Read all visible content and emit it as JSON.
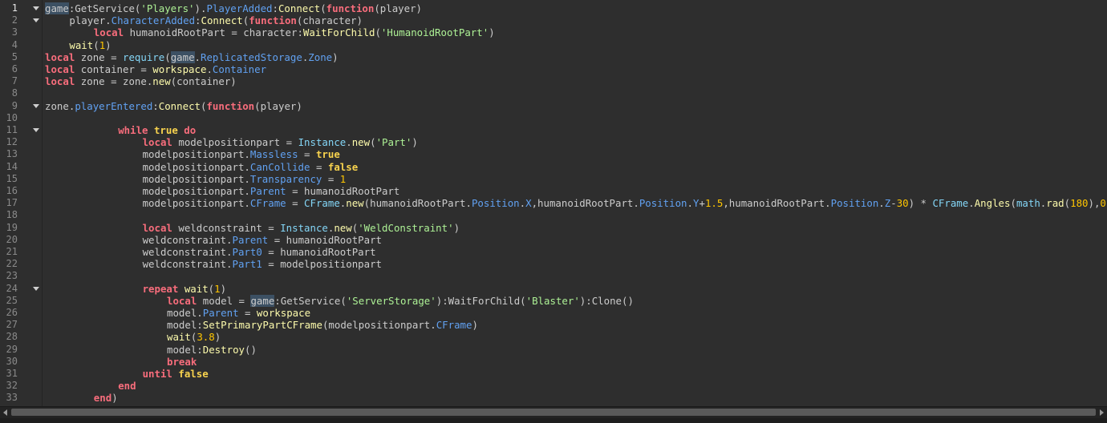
{
  "editor": {
    "current_line": 1,
    "colors": {
      "background": "#2e2e2e",
      "plain": "#cccccc",
      "keyword": "#f86d7c",
      "boolean": "#f8d34e",
      "string": "#adf195",
      "number": "#ffc600",
      "property": "#61a1f1",
      "method": "#fdfbac",
      "builtin": "#84d6f7",
      "highlight": "#3c5063"
    },
    "lines": [
      {
        "n": "1",
        "indent": 0,
        "fold": true,
        "tokens": [
          [
            "hl",
            "game"
          ],
          [
            "p",
            ":GetService("
          ],
          [
            "s",
            "'Players'"
          ],
          [
            "p",
            ")."
          ],
          [
            "prop",
            "PlayerAdded"
          ],
          [
            "p",
            ":"
          ],
          [
            "fn",
            "Connect"
          ],
          [
            "p",
            "("
          ],
          [
            "kw",
            "function"
          ],
          [
            "p",
            "(player)"
          ]
        ]
      },
      {
        "n": "2",
        "indent": 4,
        "fold": true,
        "tokens": [
          [
            "p",
            "player."
          ],
          [
            "prop",
            "CharacterAdded"
          ],
          [
            "p",
            ":"
          ],
          [
            "fn",
            "Connect"
          ],
          [
            "p",
            "("
          ],
          [
            "kw",
            "function"
          ],
          [
            "p",
            "(character)"
          ]
        ]
      },
      {
        "n": "3",
        "indent": 8,
        "tokens": [
          [
            "kw",
            "local"
          ],
          [
            "p",
            " humanoidRootPart = character:"
          ],
          [
            "fn",
            "WaitForChild"
          ],
          [
            "p",
            "("
          ],
          [
            "s",
            "'HumanoidRootPart'"
          ],
          [
            "p",
            ")"
          ]
        ]
      },
      {
        "n": "4",
        "indent": 4,
        "tokens": [
          [
            "fn",
            "wait"
          ],
          [
            "p",
            "("
          ],
          [
            "num",
            "1"
          ],
          [
            "p",
            ")"
          ]
        ]
      },
      {
        "n": "5",
        "indent": 0,
        "tokens": [
          [
            "kw",
            "local"
          ],
          [
            "p",
            " zone = "
          ],
          [
            "bi",
            "require"
          ],
          [
            "p",
            "("
          ],
          [
            "hl",
            "game"
          ],
          [
            "p",
            "."
          ],
          [
            "prop",
            "ReplicatedStorage"
          ],
          [
            "p",
            "."
          ],
          [
            "prop",
            "Zone"
          ],
          [
            "p",
            ")"
          ]
        ]
      },
      {
        "n": "6",
        "indent": 0,
        "tokens": [
          [
            "kw",
            "local"
          ],
          [
            "p",
            " container = "
          ],
          [
            "fn",
            "workspace"
          ],
          [
            "p",
            "."
          ],
          [
            "prop",
            "Container"
          ]
        ]
      },
      {
        "n": "7",
        "indent": 0,
        "tokens": [
          [
            "kw",
            "local"
          ],
          [
            "p",
            " zone = zone."
          ],
          [
            "fn",
            "new"
          ],
          [
            "p",
            "(container)"
          ]
        ]
      },
      {
        "n": "8",
        "indent": 0,
        "tokens": []
      },
      {
        "n": "9",
        "indent": 0,
        "fold": true,
        "tokens": [
          [
            "p",
            "zone."
          ],
          [
            "prop",
            "playerEntered"
          ],
          [
            "p",
            ":"
          ],
          [
            "fn",
            "Connect"
          ],
          [
            "p",
            "("
          ],
          [
            "kw",
            "function"
          ],
          [
            "p",
            "(player)"
          ]
        ]
      },
      {
        "n": "10",
        "indent": 0,
        "tokens": []
      },
      {
        "n": "11",
        "indent": 12,
        "fold": true,
        "tokens": [
          [
            "kw",
            "while"
          ],
          [
            "p",
            " "
          ],
          [
            "kwb",
            "true"
          ],
          [
            "p",
            " "
          ],
          [
            "kw",
            "do"
          ]
        ]
      },
      {
        "n": "12",
        "indent": 16,
        "tokens": [
          [
            "kw",
            "local"
          ],
          [
            "p",
            " modelpositionpart = "
          ],
          [
            "bi",
            "Instance"
          ],
          [
            "p",
            "."
          ],
          [
            "fn",
            "new"
          ],
          [
            "p",
            "("
          ],
          [
            "s",
            "'Part'"
          ],
          [
            "p",
            ")"
          ]
        ]
      },
      {
        "n": "13",
        "indent": 16,
        "tokens": [
          [
            "p",
            "modelpositionpart."
          ],
          [
            "prop",
            "Massless"
          ],
          [
            "p",
            " = "
          ],
          [
            "kwb",
            "true"
          ]
        ]
      },
      {
        "n": "14",
        "indent": 16,
        "tokens": [
          [
            "p",
            "modelpositionpart."
          ],
          [
            "prop",
            "CanCollide"
          ],
          [
            "p",
            " = "
          ],
          [
            "kwb",
            "false"
          ]
        ]
      },
      {
        "n": "15",
        "indent": 16,
        "tokens": [
          [
            "p",
            "modelpositionpart."
          ],
          [
            "prop",
            "Transparency"
          ],
          [
            "p",
            " = "
          ],
          [
            "num",
            "1"
          ]
        ]
      },
      {
        "n": "16",
        "indent": 16,
        "tokens": [
          [
            "p",
            "modelpositionpart."
          ],
          [
            "prop",
            "Parent"
          ],
          [
            "p",
            " = humanoidRootPart"
          ]
        ]
      },
      {
        "n": "17",
        "indent": 16,
        "tokens": [
          [
            "p",
            "modelpositionpart."
          ],
          [
            "prop",
            "CFrame"
          ],
          [
            "p",
            " = "
          ],
          [
            "bi",
            "CFrame"
          ],
          [
            "p",
            "."
          ],
          [
            "fn",
            "new"
          ],
          [
            "p",
            "(humanoidRootPart."
          ],
          [
            "prop",
            "Position"
          ],
          [
            "p",
            "."
          ],
          [
            "prop",
            "X"
          ],
          [
            "p",
            ",humanoidRootPart."
          ],
          [
            "prop",
            "Position"
          ],
          [
            "p",
            "."
          ],
          [
            "prop",
            "Y"
          ],
          [
            "p",
            "+"
          ],
          [
            "num",
            "1.5"
          ],
          [
            "p",
            ",humanoidRootPart."
          ],
          [
            "prop",
            "Position"
          ],
          [
            "p",
            "."
          ],
          [
            "prop",
            "Z"
          ],
          [
            "p",
            "-"
          ],
          [
            "num",
            "30"
          ],
          [
            "p",
            ") * "
          ],
          [
            "bi",
            "CFrame"
          ],
          [
            "p",
            "."
          ],
          [
            "fn",
            "Angles"
          ],
          [
            "p",
            "("
          ],
          [
            "bi",
            "math"
          ],
          [
            "p",
            "."
          ],
          [
            "fn",
            "rad"
          ],
          [
            "p",
            "("
          ],
          [
            "num",
            "180"
          ],
          [
            "p",
            "),"
          ],
          [
            "num",
            "0"
          ],
          [
            "p",
            ","
          ]
        ]
      },
      {
        "n": "18",
        "indent": 0,
        "tokens": []
      },
      {
        "n": "19",
        "indent": 16,
        "tokens": [
          [
            "kw",
            "local"
          ],
          [
            "p",
            " weldconstraint = "
          ],
          [
            "bi",
            "Instance"
          ],
          [
            "p",
            "."
          ],
          [
            "fn",
            "new"
          ],
          [
            "p",
            "("
          ],
          [
            "s",
            "'WeldConstraint'"
          ],
          [
            "p",
            ")"
          ]
        ]
      },
      {
        "n": "20",
        "indent": 16,
        "tokens": [
          [
            "p",
            "weldconstraint."
          ],
          [
            "prop",
            "Parent"
          ],
          [
            "p",
            " = humanoidRootPart"
          ]
        ]
      },
      {
        "n": "21",
        "indent": 16,
        "tokens": [
          [
            "p",
            "weldconstraint."
          ],
          [
            "prop",
            "Part0"
          ],
          [
            "p",
            " = humanoidRootPart"
          ]
        ]
      },
      {
        "n": "22",
        "indent": 16,
        "tokens": [
          [
            "p",
            "weldconstraint."
          ],
          [
            "prop",
            "Part1"
          ],
          [
            "p",
            " = modelpositionpart"
          ]
        ]
      },
      {
        "n": "23",
        "indent": 0,
        "tokens": []
      },
      {
        "n": "24",
        "indent": 16,
        "fold": true,
        "tokens": [
          [
            "kw",
            "repeat"
          ],
          [
            "p",
            " "
          ],
          [
            "fn",
            "wait"
          ],
          [
            "p",
            "("
          ],
          [
            "num",
            "1"
          ],
          [
            "p",
            ")"
          ]
        ]
      },
      {
        "n": "25",
        "indent": 20,
        "tokens": [
          [
            "kw",
            "local"
          ],
          [
            "p",
            " model = "
          ],
          [
            "hl",
            "game"
          ],
          [
            "p",
            ":GetService("
          ],
          [
            "s",
            "'ServerStorage'"
          ],
          [
            "p",
            "):WaitForChild("
          ],
          [
            "s",
            "'Blaster'"
          ],
          [
            "p",
            "):Clone()"
          ]
        ]
      },
      {
        "n": "26",
        "indent": 20,
        "tokens": [
          [
            "p",
            "model."
          ],
          [
            "prop",
            "Parent"
          ],
          [
            "p",
            " = "
          ],
          [
            "fn",
            "workspace"
          ]
        ]
      },
      {
        "n": "27",
        "indent": 20,
        "tokens": [
          [
            "p",
            "model:"
          ],
          [
            "fn",
            "SetPrimaryPartCFrame"
          ],
          [
            "p",
            "(modelpositionpart."
          ],
          [
            "prop",
            "CFrame"
          ],
          [
            "p",
            ")"
          ]
        ]
      },
      {
        "n": "28",
        "indent": 20,
        "tokens": [
          [
            "fn",
            "wait"
          ],
          [
            "p",
            "("
          ],
          [
            "num",
            "3.8"
          ],
          [
            "p",
            ")"
          ]
        ]
      },
      {
        "n": "29",
        "indent": 20,
        "tokens": [
          [
            "p",
            "model:"
          ],
          [
            "fn",
            "Destroy"
          ],
          [
            "p",
            "()"
          ]
        ]
      },
      {
        "n": "30",
        "indent": 20,
        "tokens": [
          [
            "kw",
            "break"
          ]
        ]
      },
      {
        "n": "31",
        "indent": 16,
        "tokens": [
          [
            "kw",
            "until"
          ],
          [
            "p",
            " "
          ],
          [
            "kwb",
            "false"
          ]
        ]
      },
      {
        "n": "32",
        "indent": 12,
        "tokens": [
          [
            "kw",
            "end"
          ]
        ]
      },
      {
        "n": "33",
        "indent": 8,
        "tokens": [
          [
            "kw",
            "end"
          ],
          [
            "p",
            ")"
          ]
        ]
      }
    ]
  },
  "scrollbar": {
    "left_icon": "arrow-left-icon",
    "right_icon": "arrow-right-icon"
  }
}
